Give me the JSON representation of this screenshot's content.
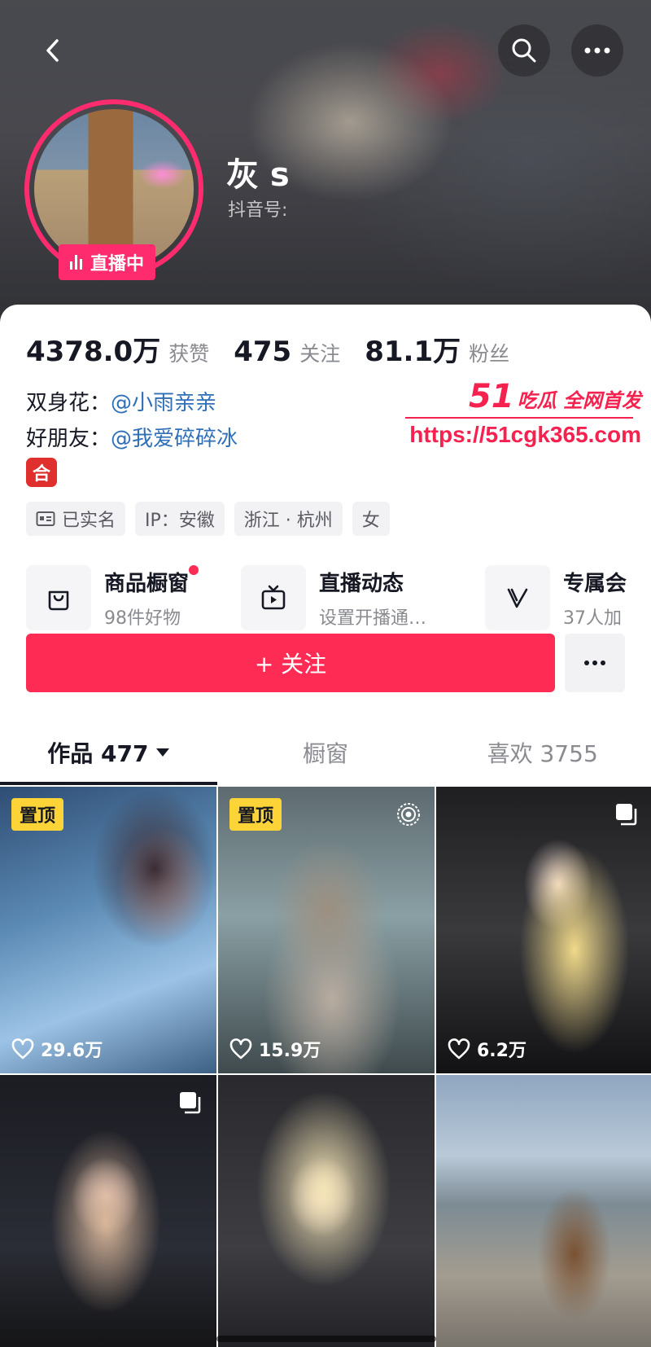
{
  "profile": {
    "nickname": "灰 s",
    "douyin_id_label": "抖音号:",
    "live_label": "直播中"
  },
  "stats": [
    {
      "value": "4378.0万",
      "label": "获赞"
    },
    {
      "value": "475",
      "label": "关注"
    },
    {
      "value": "81.1万",
      "label": "粉丝"
    }
  ],
  "relations": [
    {
      "label": "双身花：",
      "handle": "@小雨亲亲"
    },
    {
      "label": "好朋友：",
      "handle": "@我爱碎碎冰"
    }
  ],
  "he_badge": "合",
  "tags": [
    {
      "icon": "id-card-icon",
      "text": "已实名"
    },
    {
      "icon": "",
      "text": "IP：安徽"
    },
    {
      "icon": "",
      "text": "浙江 · 杭州"
    },
    {
      "icon": "",
      "text": "女"
    }
  ],
  "features": [
    {
      "icon": "shopping-bag-icon",
      "title": "商品橱窗",
      "sub": "98件好物",
      "dot": true
    },
    {
      "icon": "tv-play-icon",
      "title": "直播动态",
      "sub": "设置开播通…",
      "dot": false
    },
    {
      "icon": "v-logo-icon",
      "title": "专属会",
      "sub": "37人加",
      "dot": false
    }
  ],
  "actions": {
    "follow_label": "+ 关注"
  },
  "tabs": [
    {
      "label": "作品 477",
      "active": true
    },
    {
      "label": "橱窗",
      "active": false
    },
    {
      "label": "喜欢 3755",
      "active": false
    }
  ],
  "videos": [
    {
      "pinned": "置顶",
      "likes": "29.6万",
      "corner": ""
    },
    {
      "pinned": "置顶",
      "likes": "15.9万",
      "corner": "live-target-icon"
    },
    {
      "pinned": "",
      "likes": "6.2万",
      "corner": "multi-image-icon"
    },
    {
      "pinned": "",
      "likes": "",
      "corner": "multi-image-icon"
    },
    {
      "pinned": "",
      "likes": "",
      "corner": ""
    },
    {
      "pinned": "",
      "likes": "",
      "corner": ""
    }
  ],
  "watermark": {
    "brand_num": "51",
    "brand_text": "吃瓜 全网首发",
    "url": "https://51cgk365.com"
  },
  "colors": {
    "accent": "#fe2c55",
    "live_ring": "#fe2c6e",
    "pin": "#fdd437",
    "link": "#2f6fb8"
  }
}
